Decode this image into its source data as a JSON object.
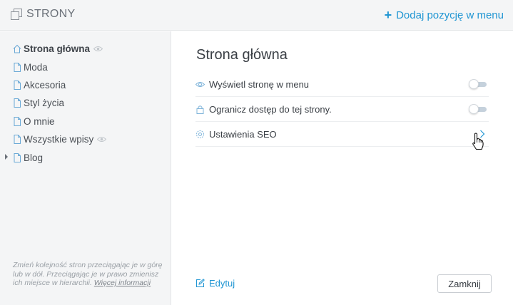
{
  "header": {
    "title": "STRONY",
    "add_label": "Dodaj pozycję w menu",
    "add_icon": "plus-icon",
    "pages_icon": "pages-icon"
  },
  "sidebar": {
    "items": [
      {
        "label": "Strona główna",
        "active": true,
        "hidden_icon": "eye-icon"
      },
      {
        "label": "Moda"
      },
      {
        "label": "Akcesoria"
      },
      {
        "label": "Styl życia"
      },
      {
        "label": "O mnie"
      },
      {
        "label": "Wszystkie wpisy",
        "hidden_icon": "eye-icon"
      },
      {
        "label": "Blog",
        "expandable": true
      }
    ],
    "hint_text": "Zmień kolejność stron przeciągając je w górę lub w dół. Przeciągając je w prawo zmienisz ich miejsce w hierarchii.",
    "hint_link": "Więcej informacji"
  },
  "main": {
    "title": "Strona główna",
    "settings": [
      {
        "label": "Wyświetl stronę w menu",
        "icon": "eye-icon",
        "control": "toggle",
        "on": false
      },
      {
        "label": "Ogranicz dostęp do tej strony.",
        "icon": "lock-icon",
        "control": "toggle",
        "on": false
      },
      {
        "label": "Ustawienia SEO",
        "icon": "gear-icon",
        "control": "chevron"
      }
    ],
    "edit_label": "Edytuj",
    "close_label": "Zamknij"
  },
  "colors": {
    "accent": "#2196d3",
    "sidebar_bg": "#f4f5f6",
    "text": "#3a3f45",
    "muted": "#9aa0a6"
  }
}
